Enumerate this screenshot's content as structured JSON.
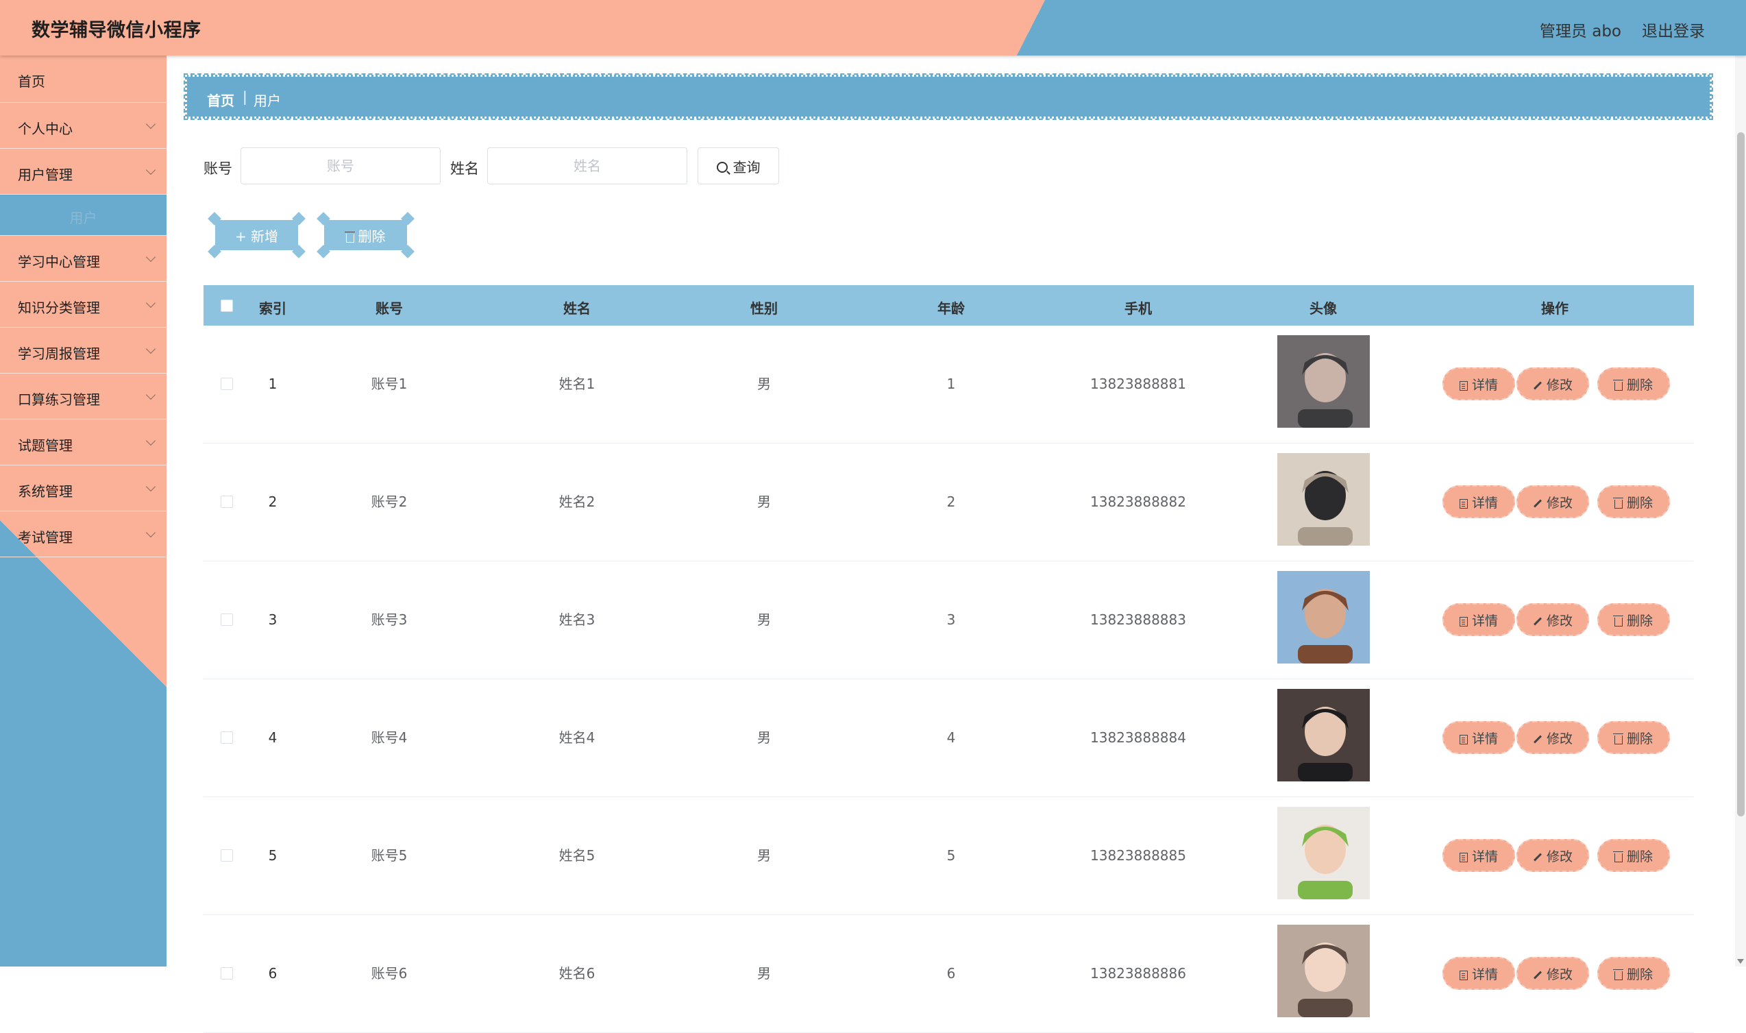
{
  "app": {
    "title": "数学辅导微信小程序"
  },
  "header": {
    "user": "管理员 abo",
    "logout": "退出登录"
  },
  "sidebar": {
    "home": "首页",
    "items": [
      {
        "label": "个人中心"
      },
      {
        "label": "用户管理"
      },
      {
        "label": "学习中心管理"
      },
      {
        "label": "知识分类管理"
      },
      {
        "label": "学习周报管理"
      },
      {
        "label": "口算练习管理"
      },
      {
        "label": "试题管理"
      },
      {
        "label": "系统管理"
      },
      {
        "label": "考试管理"
      }
    ],
    "active_sub": "用户"
  },
  "breadcrumb": {
    "home": "首页",
    "separator": "|",
    "current": "用户"
  },
  "search": {
    "account_label": "账号",
    "account_placeholder": "账号",
    "account_value": "",
    "name_label": "姓名",
    "name_placeholder": "姓名",
    "name_value": "",
    "query": "查询"
  },
  "toolbar": {
    "add": "+ 新增",
    "delete": "删除"
  },
  "table": {
    "headers": {
      "index": "索引",
      "account": "账号",
      "name": "姓名",
      "gender": "性别",
      "age": "年龄",
      "phone": "手机",
      "avatar": "头像",
      "actions": "操作"
    },
    "actions": {
      "detail": "详情",
      "edit": "修改",
      "delete": "删除"
    },
    "rows": [
      {
        "index": "1",
        "account": "账号1",
        "name": "姓名1",
        "gender": "男",
        "age": "1",
        "phone": "13823888881"
      },
      {
        "index": "2",
        "account": "账号2",
        "name": "姓名2",
        "gender": "男",
        "age": "2",
        "phone": "13823888882"
      },
      {
        "index": "3",
        "account": "账号3",
        "name": "姓名3",
        "gender": "男",
        "age": "3",
        "phone": "13823888883"
      },
      {
        "index": "4",
        "account": "账号4",
        "name": "姓名4",
        "gender": "男",
        "age": "4",
        "phone": "13823888884"
      },
      {
        "index": "5",
        "account": "账号5",
        "name": "姓名5",
        "gender": "男",
        "age": "5",
        "phone": "13823888885"
      },
      {
        "index": "6",
        "account": "账号6",
        "name": "姓名6",
        "gender": "男",
        "age": "6",
        "phone": "13823888886"
      }
    ]
  },
  "colors": {
    "peach": "#fab198",
    "blue": "#68abcf",
    "light_blue": "#8ec3df",
    "action_btn": "#f6ab93"
  }
}
